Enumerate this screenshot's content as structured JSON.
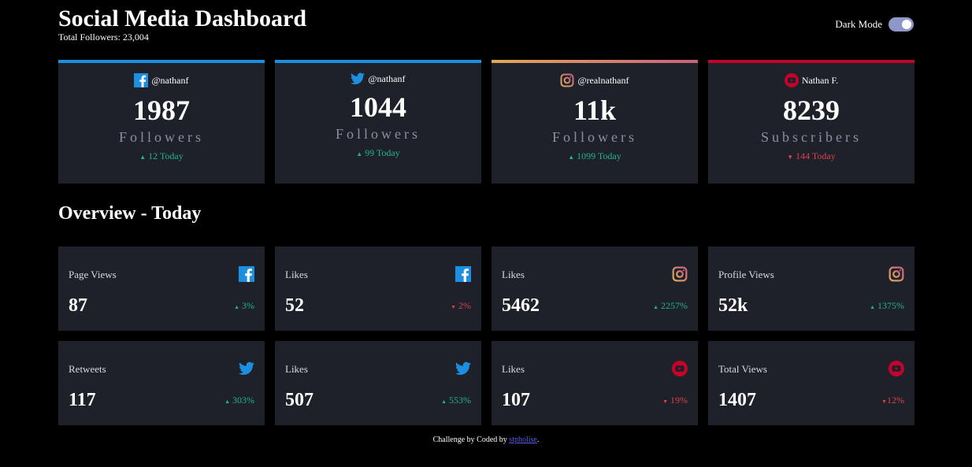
{
  "header": {
    "title": "Social Media Dashboard",
    "total_followers": "Total Followers: 23,004"
  },
  "toggle": {
    "label": "Dark Mode"
  },
  "cards": [
    {
      "handle": "@nathanf",
      "count": "1987",
      "unit": "Followers",
      "today": "12 Today",
      "trend": "up",
      "platform": "facebook"
    },
    {
      "handle": "@nathanf",
      "count": "1044",
      "unit": "Followers",
      "today": "99 Today",
      "trend": "up",
      "platform": "twitter"
    },
    {
      "handle": "@realnathanf",
      "count": "11k",
      "unit": "Followers",
      "today": "1099 Today",
      "trend": "up",
      "platform": "instagram"
    },
    {
      "handle": "Nathan F.",
      "count": "8239",
      "unit": "Subscribers",
      "today": "144 Today",
      "trend": "down",
      "platform": "youtube"
    }
  ],
  "overview": {
    "title": "Overview - Today",
    "items": [
      {
        "label": "Page Views",
        "value": "87",
        "pct": "3%",
        "trend": "up",
        "platform": "facebook"
      },
      {
        "label": "Likes",
        "value": "52",
        "pct": "2%",
        "trend": "down",
        "platform": "facebook"
      },
      {
        "label": "Likes",
        "value": "5462",
        "pct": "2257%",
        "trend": "up",
        "platform": "instagram"
      },
      {
        "label": "Profile Views",
        "value": "52k",
        "pct": "1375%",
        "trend": "up",
        "platform": "instagram"
      },
      {
        "label": "Retweets",
        "value": "117",
        "pct": "303%",
        "trend": "up",
        "platform": "twitter"
      },
      {
        "label": "Likes",
        "value": "507",
        "pct": "553%",
        "trend": "up",
        "platform": "twitter"
      },
      {
        "label": "Likes",
        "value": "107",
        "pct": "19%",
        "trend": "down",
        "platform": "youtube"
      },
      {
        "label": "Total Views",
        "value": "1407",
        "pct": "12%",
        "trend": "down",
        "platform": "youtube"
      }
    ]
  },
  "footer": {
    "text": "Challenge by Coded by",
    "link": "stpholise",
    "period": "."
  },
  "colors": {
    "up": "#1eb589",
    "down": "#dc414c",
    "facebook": "#1d8fe1",
    "twitter": "#1d8fe1",
    "youtube": "#c4032a"
  }
}
